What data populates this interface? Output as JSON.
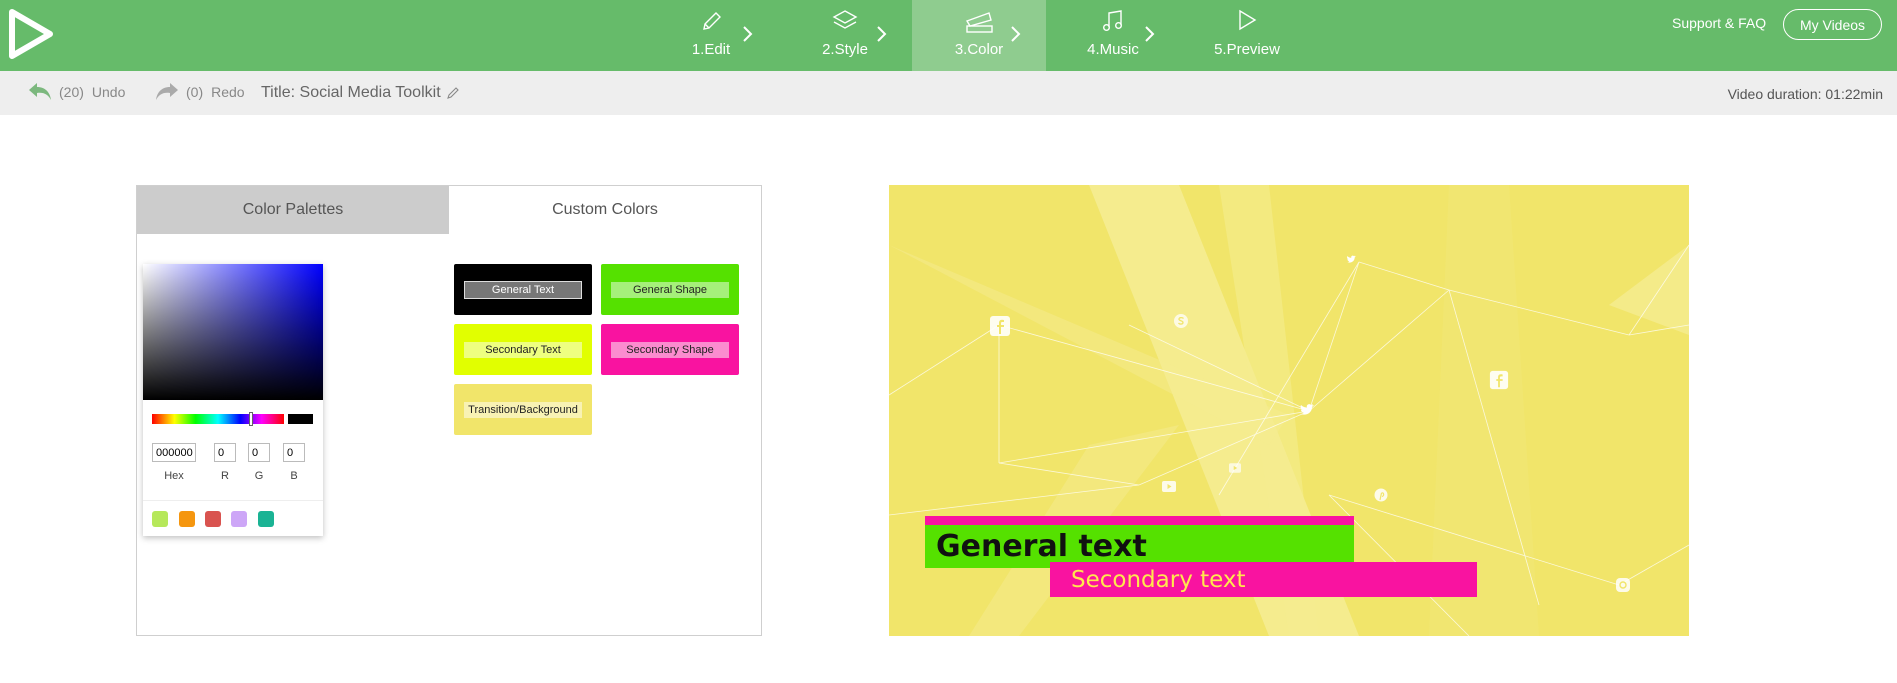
{
  "app": {
    "steps": [
      {
        "num": "1.",
        "label": "Edit",
        "icon": "pencil-icon"
      },
      {
        "num": "2.",
        "label": "Style",
        "icon": "layers-icon"
      },
      {
        "num": "3.",
        "label": "Color",
        "icon": "swatches-icon",
        "active": true
      },
      {
        "num": "4.",
        "label": "Music",
        "icon": "music-note-icon"
      },
      {
        "num": "5.",
        "label": "Preview",
        "icon": "play-icon"
      }
    ],
    "support_label": "Support & FAQ",
    "my_videos_label": "My Videos"
  },
  "toolbar": {
    "undo_count": "(20)",
    "undo_label": "Undo",
    "redo_count": "(0)",
    "redo_label": "Redo",
    "title": "Title: Social Media Toolkit",
    "duration": "Video duration: 01:22min"
  },
  "panel": {
    "tabs": [
      "Color Palettes",
      "Custom Colors"
    ],
    "active_tab": "Custom Colors",
    "picker": {
      "hex": "000000",
      "r": "0",
      "g": "0",
      "b": "0",
      "labels": {
        "hex": "Hex",
        "r": "R",
        "g": "G",
        "b": "B"
      },
      "current_color": "#000000",
      "recent_colors": [
        "#b6e85a",
        "#f5960f",
        "#d9534f",
        "#cda6f7",
        "#1ab394"
      ]
    },
    "chips": [
      {
        "label": "General Text",
        "color": "#000000"
      },
      {
        "label": "General Shape",
        "color": "#55e100"
      },
      {
        "label": "Secondary Text",
        "color": "#e1ff00"
      },
      {
        "label": "Secondary Shape",
        "color": "#f913a0"
      },
      {
        "label": "Transition/Background",
        "color": "#f1e56a"
      }
    ]
  },
  "preview": {
    "background": "#f1e56a",
    "general_text": "General text",
    "secondary_text": "Secondary text",
    "icons": [
      "facebook-icon",
      "skype-icon",
      "twitter-icon",
      "youtube-icon",
      "pinterest-icon",
      "instagram-icon"
    ]
  },
  "colors": {
    "brand_green": "#66bb6a",
    "active_step": "#8fcc8f"
  }
}
